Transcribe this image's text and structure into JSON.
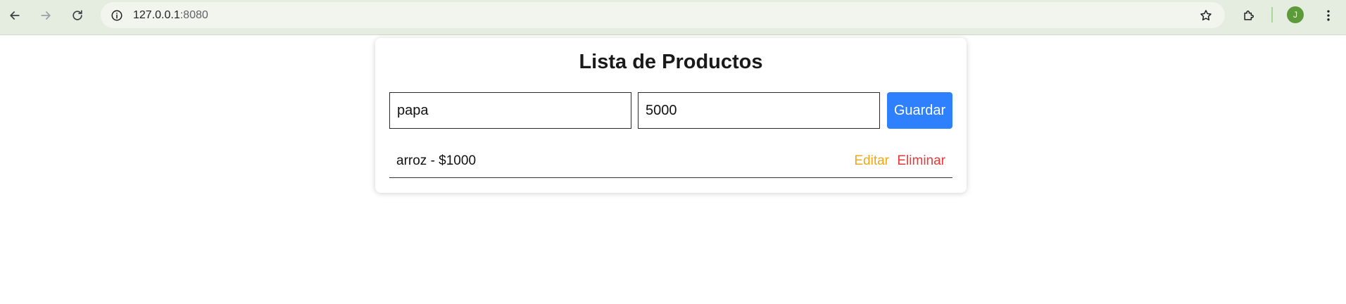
{
  "browser": {
    "url_host": "127.0.0.1",
    "url_port": ":8080",
    "profile_initial": "J",
    "icons": {
      "back": "arrow-left-icon",
      "forward": "arrow-right-icon",
      "reload": "reload-icon",
      "site_info": "info-icon",
      "bookmark": "star-icon",
      "extensions": "puzzle-icon",
      "menu": "kebab-menu-icon"
    }
  },
  "page": {
    "title": "Lista de Productos",
    "form": {
      "name_value": "papa",
      "price_value": "5000",
      "save_label": "Guardar"
    },
    "products": [
      {
        "text": "arroz - $1000",
        "edit_label": "Editar",
        "delete_label": "Eliminar"
      }
    ]
  },
  "colors": {
    "toolbar_bg": "#e5ede0",
    "save_button": "#2f80ff",
    "edit_link": "#f0a818",
    "delete_link": "#e53a3a",
    "avatar": "#5d9a3a"
  }
}
